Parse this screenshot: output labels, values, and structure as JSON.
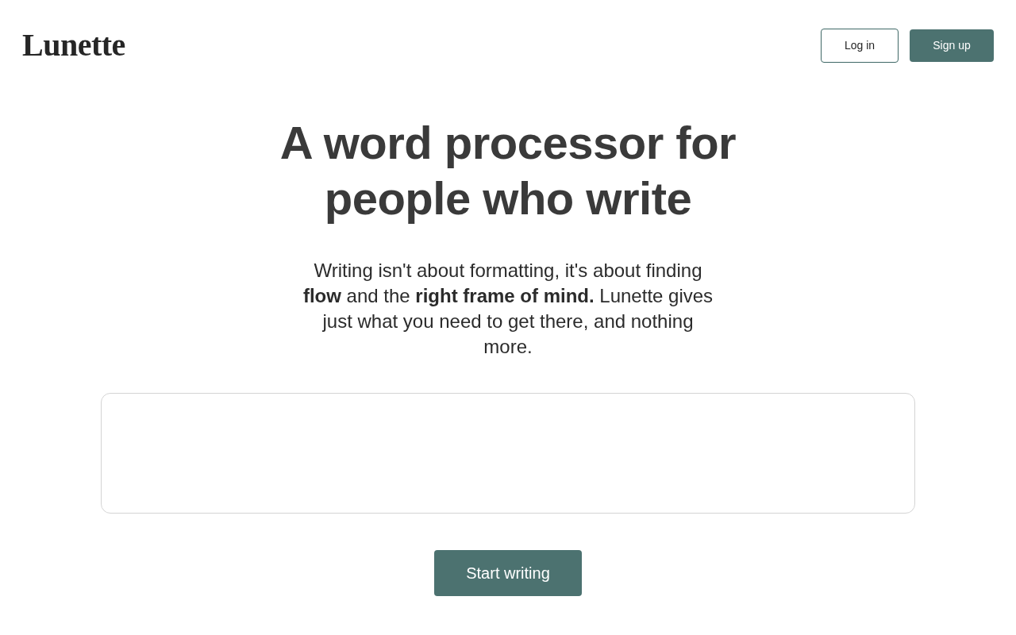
{
  "header": {
    "logo": "Lunette",
    "buttons": [
      {
        "label": "Log in",
        "kind": "outline"
      },
      {
        "label": "Sign up",
        "kind": "filled"
      }
    ]
  },
  "hero": {
    "heading": "A word processor for people who write",
    "text": "Writing isn't about formatting, it's about finding **flow** and the **right frame of mind.** Lunette gives just what you need to get there, and nothing more.",
    "cta": "Start writing"
  }
}
